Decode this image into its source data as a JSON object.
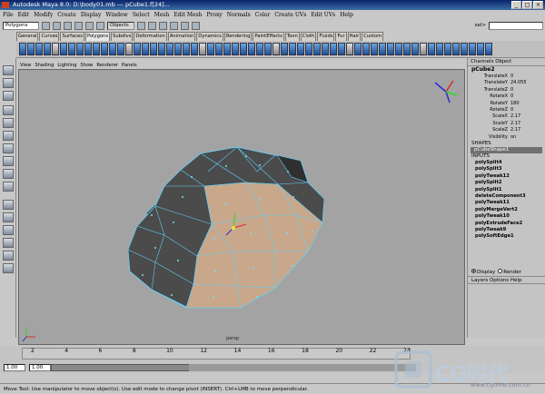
{
  "window": {
    "title": "Autodesk Maya 8.0: D:\\body01.mb   ---   pCube1.f[24]...",
    "controls": [
      "_",
      "□",
      "×"
    ]
  },
  "menubar": [
    "File",
    "Edit",
    "Modify",
    "Create",
    "Display",
    "Window",
    "Select",
    "Mesh",
    "Edit Mesh",
    "Proxy",
    "Normals",
    "Color",
    "Create UVs",
    "Edit UVs",
    "Help"
  ],
  "statusline": {
    "mode": "Polygons",
    "objects_label": "Objects",
    "sel_label": "sel>"
  },
  "shelf_tabs": [
    "General",
    "Curves",
    "Surfaces",
    "Polygons",
    "Subdivs",
    "Deformation",
    "Animation",
    "Dynamics",
    "Rendering",
    "PaintEffects",
    "Toon",
    "Cloth",
    "Fluids",
    "Fur",
    "Hair",
    "Custom"
  ],
  "active_shelf_tab": "Polygons",
  "panel_menu": [
    "View",
    "Shading",
    "Lighting",
    "Show",
    "Renderer",
    "Panels"
  ],
  "viewport": {
    "camera": "persp",
    "bg_color": "#a3a3a3",
    "wire_color": "#5fd5ff",
    "selected_face_color": "#c9a98a"
  },
  "channel_box": {
    "menu": "Channels  Object",
    "object": "pCube2",
    "attributes": [
      {
        "name": "TranslateX",
        "value": "0"
      },
      {
        "name": "TranslateY",
        "value": "24.055"
      },
      {
        "name": "TranslateZ",
        "value": "0"
      },
      {
        "name": "RotateX",
        "value": "0"
      },
      {
        "name": "RotateY",
        "value": "180"
      },
      {
        "name": "RotateZ",
        "value": "0"
      },
      {
        "name": "ScaleX",
        "value": "2.17"
      },
      {
        "name": "ScaleY",
        "value": "2.17"
      },
      {
        "name": "ScaleZ",
        "value": "2.17"
      },
      {
        "name": "Visibility",
        "value": "on"
      }
    ],
    "shapes_label": "SHAPES",
    "shape": "pCubeShape1",
    "inputs_label": "INPUTS",
    "inputs": [
      "polySplit4",
      "polySplit3",
      "polyTweak12",
      "polySplit2",
      "polySplit1",
      "deleteComponent3",
      "polyTweak11",
      "polyMergeVert2",
      "polyTweak10",
      "polyExtrudeFace2",
      "polyTweak9",
      "polySoftEdge1"
    ]
  },
  "display": {
    "display_label": "Display",
    "render_label": "Render"
  },
  "layers_menu": "Layers  Options  Help",
  "timeline": {
    "ticks": [
      "2",
      "4",
      "6",
      "8",
      "10",
      "12",
      "14",
      "16",
      "18",
      "20",
      "22",
      "24"
    ],
    "start": "1.00",
    "end": "1.00"
  },
  "help_line": "Move Tool: Use manipulator to move object(s). Use edit mode to change pivot (INSERT). Ctrl+LMB to move perpendicular.",
  "watermark": {
    "brand": "CG时代",
    "url": "www.cgtime.com.cn"
  }
}
